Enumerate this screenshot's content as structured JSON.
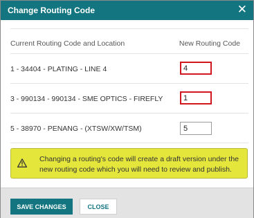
{
  "dialog": {
    "title": "Change Routing Code",
    "close_icon": "close-icon"
  },
  "table": {
    "col_current": "Current Routing Code and Location",
    "col_new": "New Routing Code",
    "rows": [
      {
        "label": "1 - 34404 - PLATING - LINE 4",
        "new_code": "4",
        "error": true
      },
      {
        "label": "3 - 990134 - 990134 - SME OPTICS - FIREFLY",
        "new_code": "1",
        "error": true
      },
      {
        "label": "5 - 38970 - PENANG - (XTSW/XW/TSM)",
        "new_code": "5",
        "error": false
      }
    ]
  },
  "warning": {
    "icon": "warning-icon",
    "text": "Changing a routing's code will create a draft version under the new routing code which you will need to review and publish."
  },
  "footer": {
    "save_label": "SAVE CHANGES",
    "close_label": "CLOSE"
  },
  "colors": {
    "accent": "#127580",
    "warning_bg": "#e4e63c",
    "error_border": "#d0161e"
  }
}
